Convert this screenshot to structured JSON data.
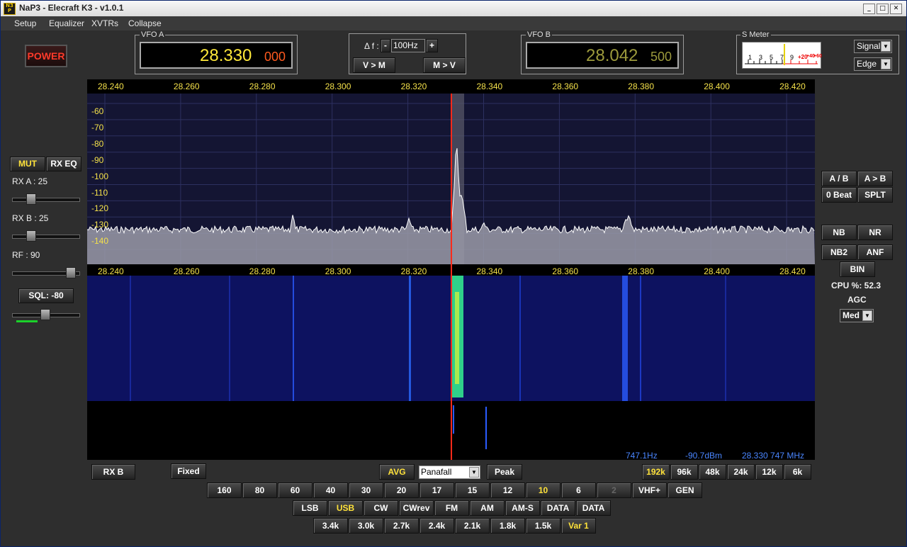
{
  "window": {
    "title": "NaP3 - Elecraft K3 - v1.0.1",
    "logo_text": "NaP3"
  },
  "menu": [
    "Setup",
    "Equalizer",
    "XVTRs",
    "Collapse"
  ],
  "power_label": "POWER",
  "vfo_a": {
    "label": "VFO A",
    "main": "28.330",
    "sub": "000"
  },
  "vfo_b": {
    "label": "VFO B",
    "main": "28.042",
    "sub": "500"
  },
  "delta": {
    "label": "Δ f :",
    "minus": "-",
    "value": "100Hz",
    "plus": "+",
    "v_to_m": "V > M",
    "m_to_v": "M > V"
  },
  "smeter": {
    "label": "S Meter",
    "scale": [
      "1",
      "3",
      "5",
      "7",
      "9",
      "+20",
      "+40",
      "+60"
    ],
    "mode_select": "Signal",
    "trigger_select": "Edge"
  },
  "left": {
    "mut": "MUT",
    "rx_eq": "RX EQ",
    "rx_a_label": "RX A :  25",
    "rx_a_level": 25,
    "rx_b_label": "RX B :  25",
    "rx_b_level": 25,
    "rf_label": "RF :  90",
    "rf_level": 90,
    "sql_label": "SQL: -80",
    "sql_level": -80
  },
  "right": {
    "a_b": "A / B",
    "a_to_b": "A > B",
    "zero_beat": "0 Beat",
    "split": "SPLT",
    "nb": "NB",
    "nr": "NR",
    "nb2": "NB2",
    "anf": "ANF",
    "bin": "BIN",
    "cpu": "CPU %: 52.3",
    "agc_label": "AGC",
    "agc_value": "Med"
  },
  "spectrum": {
    "freq_ticks": [
      "28.240",
      "28.260",
      "28.280",
      "28.300",
      "28.320",
      "28.340",
      "28.360",
      "28.380",
      "28.400",
      "28.420"
    ],
    "db_ticks": [
      "-60",
      "-70",
      "-80",
      "-90",
      "-100",
      "-110",
      "-120",
      "-130",
      "-140"
    ],
    "cursor_freq_mhz": 28.33
  },
  "waterfall": {
    "freq_ticks": [
      "28.240",
      "28.260",
      "28.280",
      "28.300",
      "28.320",
      "28.340",
      "28.360",
      "28.380",
      "28.400",
      "28.420"
    ],
    "readout_hz": "747.1Hz",
    "readout_dbm": "-90.7dBm",
    "readout_freq": "28.330 747 MHz"
  },
  "controls": {
    "rx_b": "RX  B",
    "fixed": "Fixed",
    "avg": "AVG",
    "display_mode": "Panafall",
    "peak": "Peak",
    "spans": [
      "192k",
      "96k",
      "48k",
      "24k",
      "12k",
      "6k"
    ],
    "span_selected": "192k"
  },
  "bands": [
    "160",
    "80",
    "60",
    "40",
    "30",
    "20",
    "17",
    "15",
    "12",
    "10",
    "6",
    "2",
    "VHF+",
    "GEN"
  ],
  "band_selected": "10",
  "modes": [
    "LSB",
    "USB",
    "CW",
    "CWrev",
    "FM",
    "AM",
    "AM-S",
    "DATA",
    "DATA"
  ],
  "mode_selected": "USB",
  "filters": [
    "3.4k",
    "3.0k",
    "2.7k",
    "2.4k",
    "2.1k",
    "1.8k",
    "1.5k",
    "Var 1"
  ],
  "filter_selected": "Var 1",
  "colors": {
    "vfo_a": "#ffe93a",
    "vfo_a_sub": "#ff5a1f",
    "vfo_b": "#9c9a3c",
    "axis": "#f4e14a",
    "readout": "#4a86ff",
    "cursor": "#ff2a1a"
  }
}
